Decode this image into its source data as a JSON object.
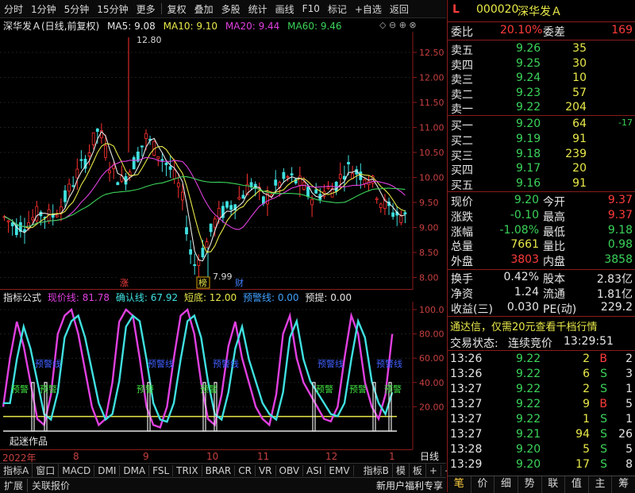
{
  "toolbar": {
    "period_tabs": [
      "分时",
      "1分钟",
      "5分钟",
      "15分钟",
      "更多"
    ],
    "actions": [
      "复权",
      "叠加",
      "多股",
      "统计",
      "画线",
      "F10",
      "标记",
      "+自选",
      "返回"
    ]
  },
  "chart_header": {
    "stock": "深华发Ａ(日线,前复权)",
    "ma5": "MA5: 9.08",
    "ma10": "MA10: 9.10",
    "ma20": "MA20: 9.44",
    "ma60": "MA60: 9.46"
  },
  "price_axis": [
    "12.50",
    "12.00",
    "11.50",
    "11.00",
    "10.50",
    "10.00",
    "9.50",
    "9.00",
    "8.50",
    "8.00"
  ],
  "price_annotations": {
    "high": "12.80",
    "low": "7.99"
  },
  "event_markers": [
    "涨",
    "榜",
    "财"
  ],
  "indicator_header": {
    "name": "指标公式",
    "line1": "现价线: 81.78",
    "line2": "确认线: 67.92",
    "line3": "短底: 12.00",
    "line4": "预警线: 0.00",
    "line5": "预提: 0.00"
  },
  "indicator_axis": [
    "100.0",
    "80.00",
    "60.00",
    "40.00",
    "20.00"
  ],
  "indicator_labels": {
    "warn": "预警",
    "warn_line": "预警线",
    "watermark": "起迷作品"
  },
  "date_axis": [
    "2022年",
    "8",
    "9",
    "10",
    "11",
    "12",
    "1"
  ],
  "period_label": "日线",
  "indicator_tabs": [
    "指标A",
    "窗口",
    "MACD",
    "DMI",
    "DMA",
    "FSL",
    "TRIX",
    "BRAR",
    "CR",
    "VR",
    "OBV",
    "ASI",
    "EMV",
    "指标B",
    "模",
    "板",
    "+",
    "−"
  ],
  "status_bar": {
    "left1": "扩展",
    "left2": "关联报价",
    "right": "新用户福利专享"
  },
  "quote": {
    "marker": "L",
    "code": "000020",
    "name": "深华发Ａ",
    "weibi_label": "委比",
    "weibi": "20.10%",
    "weicha_label": "委差",
    "weicha": "169",
    "asks": [
      {
        "label": "卖五",
        "price": "9.26",
        "vol": "35"
      },
      {
        "label": "卖四",
        "price": "9.25",
        "vol": "30"
      },
      {
        "label": "卖三",
        "price": "9.24",
        "vol": "10"
      },
      {
        "label": "卖二",
        "price": "9.23",
        "vol": "57"
      },
      {
        "label": "卖一",
        "price": "9.22",
        "vol": "204"
      }
    ],
    "bids": [
      {
        "label": "买一",
        "price": "9.20",
        "vol": "64",
        "chg": "-17"
      },
      {
        "label": "买二",
        "price": "9.19",
        "vol": "91",
        "chg": ""
      },
      {
        "label": "买三",
        "price": "9.18",
        "vol": "239",
        "chg": ""
      },
      {
        "label": "买四",
        "price": "9.17",
        "vol": "20",
        "chg": ""
      },
      {
        "label": "买五",
        "price": "9.16",
        "vol": "91",
        "chg": ""
      }
    ],
    "stats": [
      {
        "l1": "现价",
        "v1": "9.20",
        "l2": "今开",
        "v2": "9.37"
      },
      {
        "l1": "涨跌",
        "v1": "-0.10",
        "l2": "最高",
        "v2": "9.37"
      },
      {
        "l1": "涨幅",
        "v1": "-1.08%",
        "l2": "最低",
        "v2": "9.18"
      },
      {
        "l1": "总量",
        "v1": "7661",
        "l2": "量比",
        "v2": "0.98"
      },
      {
        "l1": "外盘",
        "v1": "3803",
        "l2": "内盘",
        "v2": "3858"
      }
    ],
    "stats2": [
      {
        "l1": "换手",
        "v1": "0.42%",
        "l2": "股本",
        "v2": "2.83亿"
      },
      {
        "l1": "净资",
        "v1": "1.24",
        "l2": "流通",
        "v2": "1.81亿"
      },
      {
        "l1": "收益(三)",
        "v1": "0.030",
        "l2": "PE(动)",
        "v2": "229.2"
      }
    ],
    "promo": "通达信，仅需20元查看千档行情",
    "trade_status_label": "交易状态:",
    "trade_status": "连续竞价",
    "trade_time": "13:29:51",
    "ticks": [
      {
        "t": "13:26",
        "p": "9.22",
        "v": "2",
        "bs": "B",
        "n": "2"
      },
      {
        "t": "13:26",
        "p": "9.22",
        "v": "6",
        "bs": "S",
        "n": "3"
      },
      {
        "t": "13:27",
        "p": "9.22",
        "v": "2",
        "bs": "S",
        "n": "1"
      },
      {
        "t": "13:27",
        "p": "9.22",
        "v": "9",
        "bs": "B",
        "n": "5"
      },
      {
        "t": "13:27",
        "p": "9.22",
        "v": "1",
        "bs": "S",
        "n": "1"
      },
      {
        "t": "13:27",
        "p": "9.21",
        "v": "94",
        "bs": "S",
        "n": "26"
      },
      {
        "t": "13:28",
        "p": "9.20",
        "v": "5",
        "bs": "S",
        "n": "5"
      },
      {
        "t": "13:29",
        "p": "9.20",
        "v": "17",
        "bs": "S",
        "n": "8"
      }
    ],
    "bottom_tabs": [
      "笔",
      "价",
      "细",
      "势",
      "联",
      "值",
      "主",
      "筹"
    ]
  }
}
